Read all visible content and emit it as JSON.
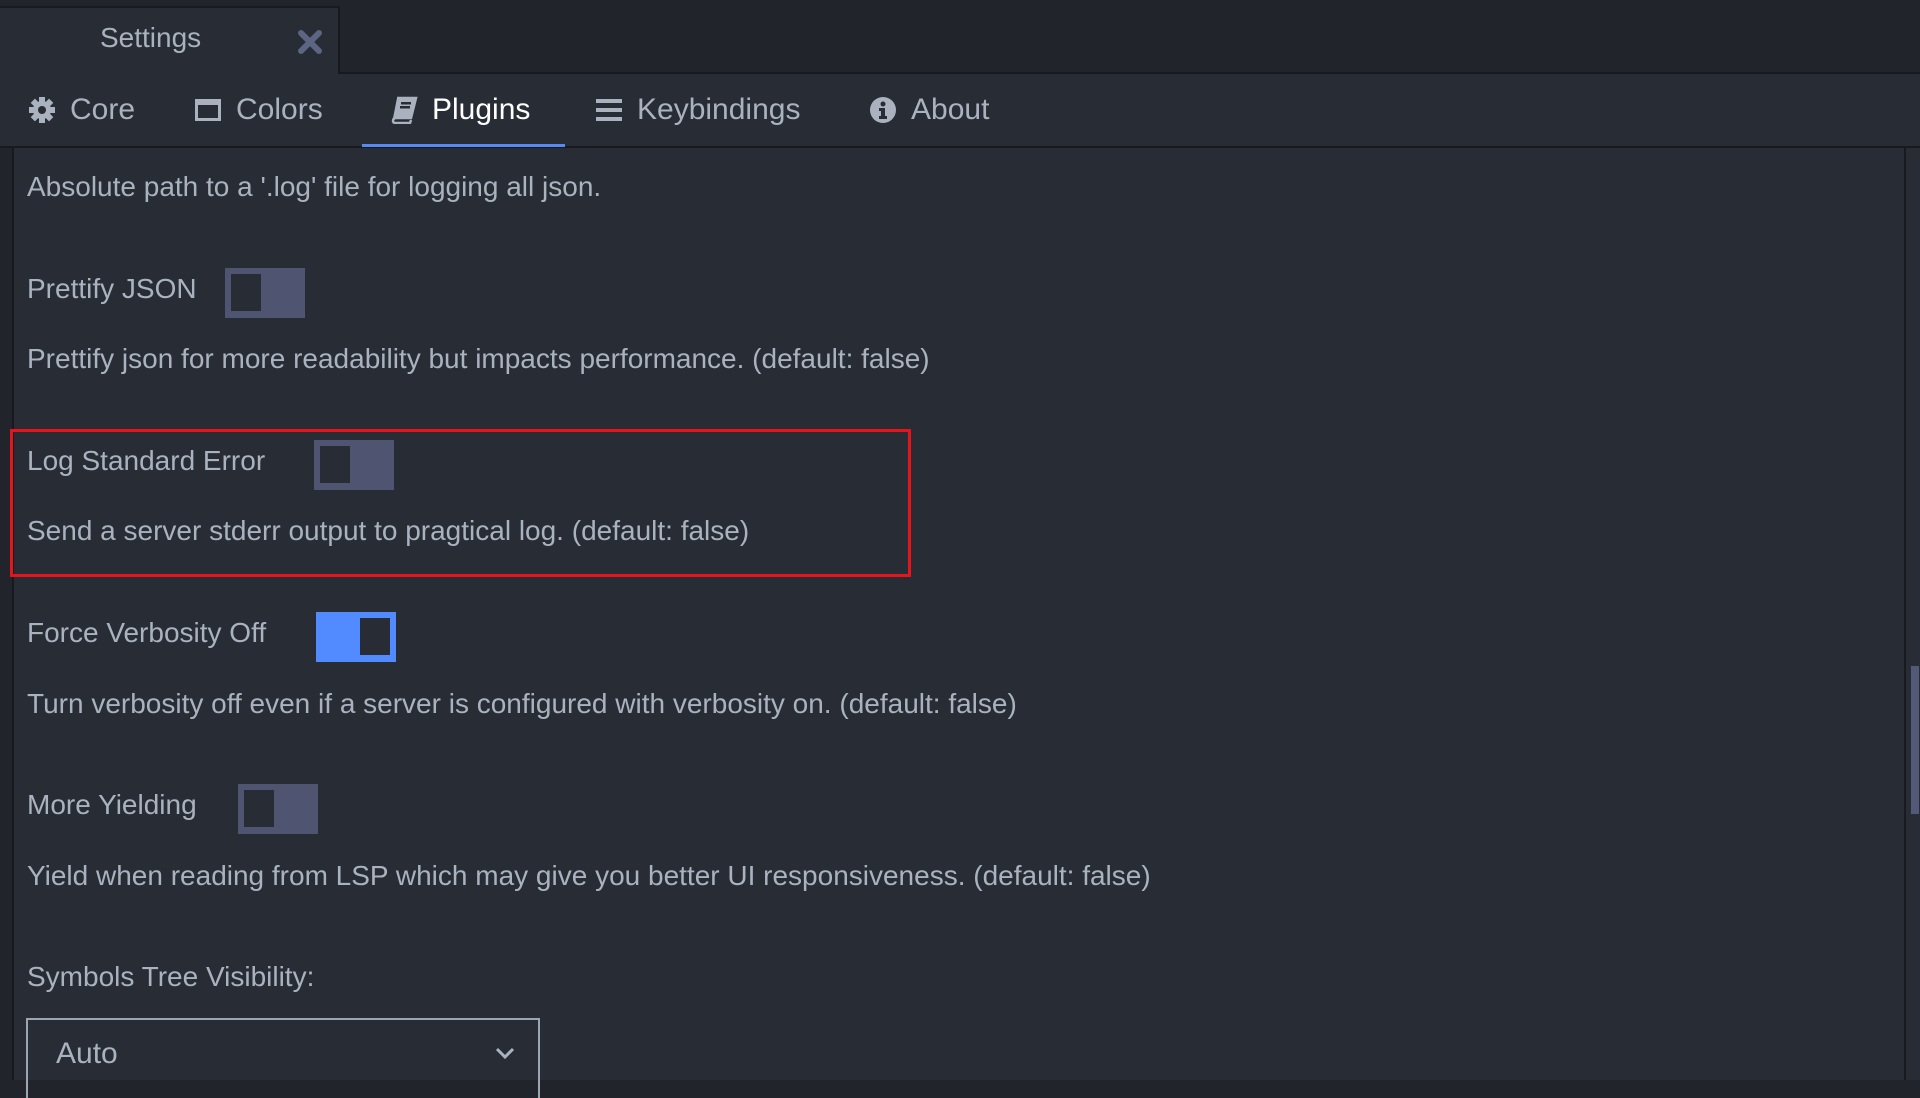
{
  "tab": {
    "title": "Settings",
    "close_icon": "close-icon"
  },
  "nav": {
    "items": [
      {
        "label": "Core",
        "icon": "gear-icon",
        "active": false
      },
      {
        "label": "Colors",
        "icon": "window-icon",
        "active": false
      },
      {
        "label": "Plugins",
        "icon": "book-icon",
        "active": true
      },
      {
        "label": "Keybindings",
        "icon": "list-icon",
        "active": false
      },
      {
        "label": "About",
        "icon": "info-icon",
        "active": false
      }
    ],
    "accent_color": "#568af2"
  },
  "settings": {
    "log_path_description": "Absolute path to a '.log' file for logging all json.",
    "prettify_json": {
      "label": "Prettify JSON",
      "enabled": false,
      "description": "Prettify json for more readability but impacts performance. (default: false)"
    },
    "log_standard_error": {
      "label": "Log Standard Error",
      "enabled": false,
      "description": "Send a server stderr output to pragtical log. (default: false)",
      "highlighted": true,
      "highlight_color": "#e8141c"
    },
    "force_verbosity_off": {
      "label": "Force Verbosity Off",
      "enabled": true,
      "description": "Turn verbosity off even if a server is configured with verbosity on. (default: false)"
    },
    "more_yielding": {
      "label": "More Yielding",
      "enabled": false,
      "description": "Yield when reading from LSP which may give you better UI responsiveness. (default: false)"
    },
    "symbols_tree_visibility": {
      "label": "Symbols Tree Visibility:",
      "value": "Auto"
    }
  },
  "colors": {
    "toggle_on": "#528bff",
    "toggle_off": "#4f5570"
  }
}
